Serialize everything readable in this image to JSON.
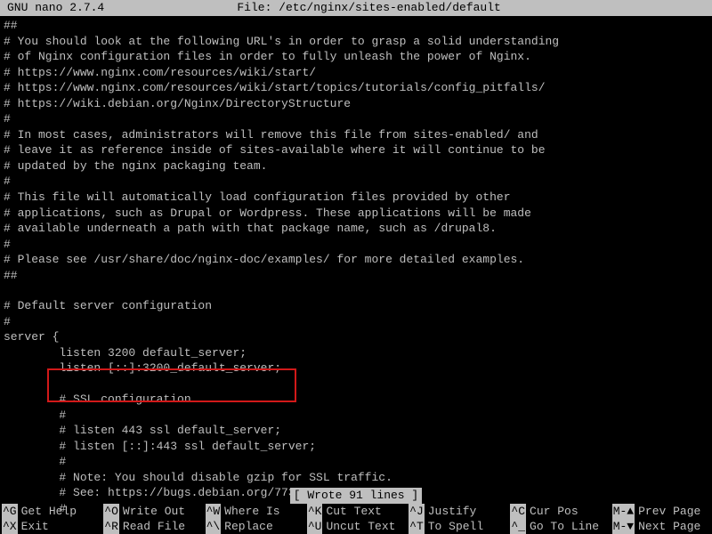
{
  "header": {
    "app": "  GNU nano 2.7.4",
    "file": "File: /etc/nginx/sites-enabled/default"
  },
  "lines": [
    "##",
    "# You should look at the following URL's in order to grasp a solid understanding",
    "# of Nginx configuration files in order to fully unleash the power of Nginx.",
    "# https://www.nginx.com/resources/wiki/start/",
    "# https://www.nginx.com/resources/wiki/start/topics/tutorials/config_pitfalls/",
    "# https://wiki.debian.org/Nginx/DirectoryStructure",
    "#",
    "# In most cases, administrators will remove this file from sites-enabled/ and",
    "# leave it as reference inside of sites-available where it will continue to be",
    "# updated by the nginx packaging team.",
    "#",
    "# This file will automatically load configuration files provided by other",
    "# applications, such as Drupal or Wordpress. These applications will be made",
    "# available underneath a path with that package name, such as /drupal8.",
    "#",
    "# Please see /usr/share/doc/nginx-doc/examples/ for more detailed examples.",
    "##",
    "",
    "# Default server configuration",
    "#",
    "server {",
    "        listen 3200 default_server;",
    "        listen [::]:3200_default_server;",
    "",
    "        # SSL configuration",
    "        #",
    "        # listen 443 ssl default_server;",
    "        # listen [::]:443 ssl default_server;",
    "        #",
    "        # Note: You should disable gzip for SSL traffic.",
    "        # See: https://bugs.debian.org/773332",
    "        #"
  ],
  "status": "[ Wrote 91 lines ]",
  "shortcuts": [
    {
      "key": "^G",
      "desc": "Get Help"
    },
    {
      "key": "^O",
      "desc": "Write Out"
    },
    {
      "key": "^W",
      "desc": "Where Is"
    },
    {
      "key": "^K",
      "desc": "Cut Text"
    },
    {
      "key": "^J",
      "desc": "Justify"
    },
    {
      "key": "^C",
      "desc": "Cur Pos"
    },
    {
      "key": "^X",
      "desc": "Exit"
    },
    {
      "key": "^R",
      "desc": "Read File"
    },
    {
      "key": "^\\",
      "desc": "Replace"
    },
    {
      "key": "^U",
      "desc": "Uncut Text"
    },
    {
      "key": "^T",
      "desc": "To Spell"
    },
    {
      "key": "^_",
      "desc": "Go To Line"
    }
  ],
  "shortcuts_extra": [
    {
      "key": "M-▲",
      "desc": "Prev Page"
    },
    {
      "key": "M-▼",
      "desc": "Next Page"
    }
  ]
}
